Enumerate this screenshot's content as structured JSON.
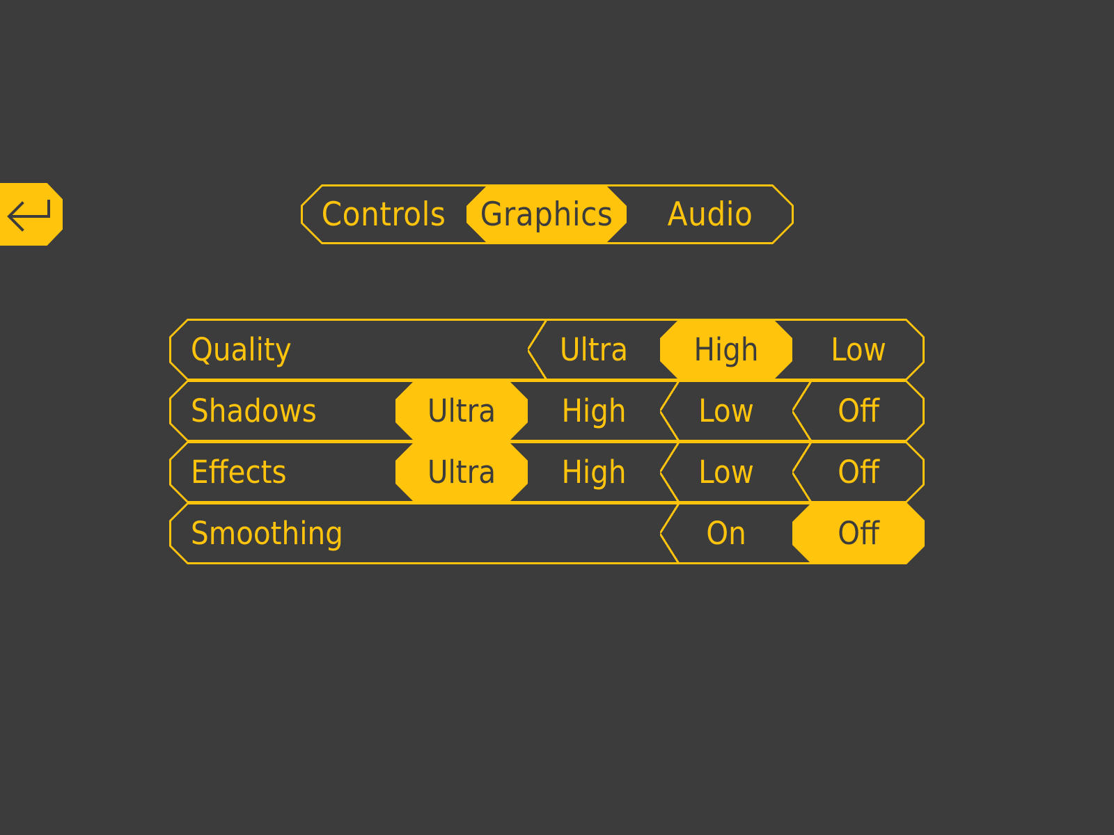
{
  "theme": {
    "background": "#3c3c3c",
    "accent": "#ffc40b",
    "text_on_accent": "#3c3c3c"
  },
  "back_button": {
    "icon": "back-arrow-icon",
    "label": ""
  },
  "tabs": [
    {
      "label": "Controls",
      "active": false
    },
    {
      "label": "Graphics",
      "active": true
    },
    {
      "label": "Audio",
      "active": false
    }
  ],
  "settings": [
    {
      "label": "Quality",
      "options": [
        {
          "label": "Ultra",
          "selected": false
        },
        {
          "label": "High",
          "selected": true
        },
        {
          "label": "Low",
          "selected": false
        }
      ]
    },
    {
      "label": "Shadows",
      "options": [
        {
          "label": "Ultra",
          "selected": true
        },
        {
          "label": "High",
          "selected": false
        },
        {
          "label": "Low",
          "selected": false
        },
        {
          "label": "Off",
          "selected": false
        }
      ]
    },
    {
      "label": "Effects",
      "options": [
        {
          "label": "Ultra",
          "selected": true
        },
        {
          "label": "High",
          "selected": false
        },
        {
          "label": "Low",
          "selected": false
        },
        {
          "label": "Off",
          "selected": false
        }
      ]
    },
    {
      "label": "Smoothing",
      "options": [
        {
          "label": "On",
          "selected": false
        },
        {
          "label": "Off",
          "selected": true
        }
      ]
    }
  ]
}
